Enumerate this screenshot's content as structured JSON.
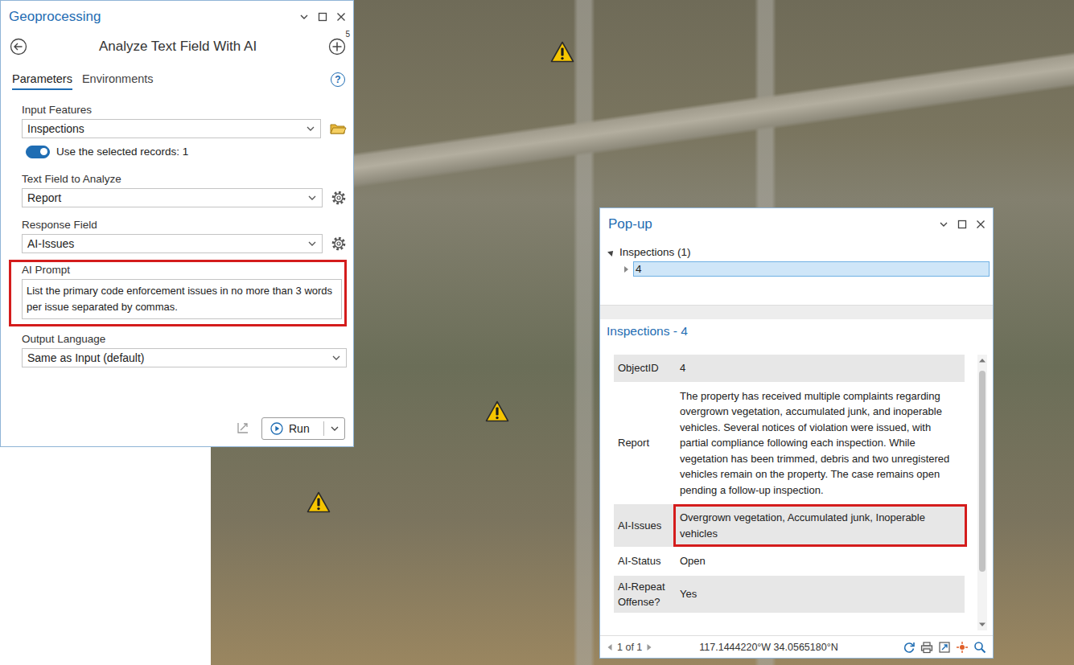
{
  "geoprocessing": {
    "title": "Geoprocessing",
    "tool_title": "Analyze Text Field With AI",
    "add_badge": "5",
    "tabs": [
      {
        "label": "Parameters",
        "selected": true
      },
      {
        "label": "Environments",
        "selected": false
      }
    ],
    "help": "?",
    "input_features": {
      "label": "Input Features",
      "value": "Inspections"
    },
    "use_selected": {
      "label": "Use the selected records: 1",
      "on": true
    },
    "fields": [
      {
        "label": "Text Field to Analyze",
        "value": "Report"
      },
      {
        "label": "Response Field",
        "value": "AI-Issues"
      }
    ],
    "prompt": {
      "label": "AI Prompt",
      "value": "List the primary code enforcement issues in no more than 3 words per issue separated by commas.",
      "highlighted": true
    },
    "output_language": {
      "label": "Output Language",
      "value": "Same as Input (default)"
    },
    "run_button": "Run"
  },
  "popup": {
    "title": "Pop-up",
    "tree": {
      "layer": "Inspections (1)",
      "expanded": true,
      "items": [
        {
          "label": "4",
          "selected": true,
          "expanded": false
        }
      ]
    },
    "heading": "Inspections - 4",
    "rows": [
      {
        "name": "ObjectID",
        "value": "4",
        "highlighted": false
      },
      {
        "name": "Report",
        "value": "The property has received multiple complaints regarding overgrown vegetation, accumulated junk, and inoperable vehicles. Several notices of violation were issued, with partial compliance following each inspection. While vegetation has been trimmed, debris and two unregistered vehicles remain on the property. The case remains open pending a follow-up inspection.",
        "highlighted": false
      },
      {
        "name": "AI-Issues",
        "value": "Overgrown vegetation, Accumulated junk, Inoperable vehicles",
        "highlighted": true
      },
      {
        "name": "AI-Status",
        "value": "Open",
        "highlighted": false
      },
      {
        "name": "AI-Repeat Offense?",
        "value": "Yes",
        "highlighted": false
      }
    ],
    "pager": "1 of 1",
    "coordinates": "117.1444220°W 34.0565180°N"
  }
}
